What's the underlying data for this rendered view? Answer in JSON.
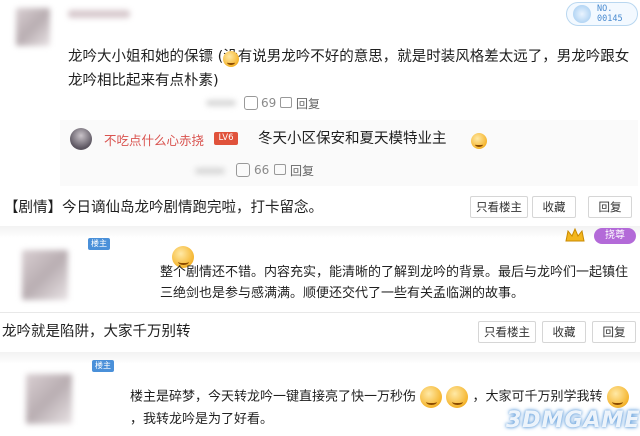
{
  "top_user": {
    "level_text": "NO.\n00145"
  },
  "comment1": {
    "text": "龙吟大小姐和她的保镖 (没有说男龙吟不好的意思，就是时装风格差太远了，男龙吟跟女龙吟相比起来有点朴素)",
    "likes": "69",
    "reply_label": "回复"
  },
  "reply1": {
    "username": "不吃点什么心赤挠",
    "level": "LV6",
    "text": "冬天小区保安和夏天模特业主",
    "likes": "66",
    "reply_label": "回复"
  },
  "post1": {
    "text": "【剧情】今日谪仙岛龙吟剧情跑完啦，打卡留念。",
    "buttons": [
      "只看楼主",
      "收藏",
      "回复"
    ]
  },
  "post2": {
    "owner_badge": "楼主",
    "vip_badge": "挠尊",
    "text": "整个剧情还不错。内容充实，能清晰的了解到龙吟的背景。最后与龙吟们一起镇住三绝剑也是参与感满满。顺便还交代了一些有关孟临渊的故事。"
  },
  "post3": {
    "text": "龙吟就是陷阱，大家千万别转",
    "buttons": [
      "只看楼主",
      "收藏",
      "回复"
    ]
  },
  "post4": {
    "owner_badge": "楼主",
    "text_a": "楼主是碎梦，今天转龙吟一键直接亮了快一万秒伤",
    "text_b": "，大家可千万别学我转",
    "text_c": "，我转龙吟是为了好看。"
  },
  "colors": {
    "accent": "#4a90d9",
    "username_red": "#d9534f",
    "level_red": "#e0523b"
  },
  "watermark": "3DMGAME"
}
